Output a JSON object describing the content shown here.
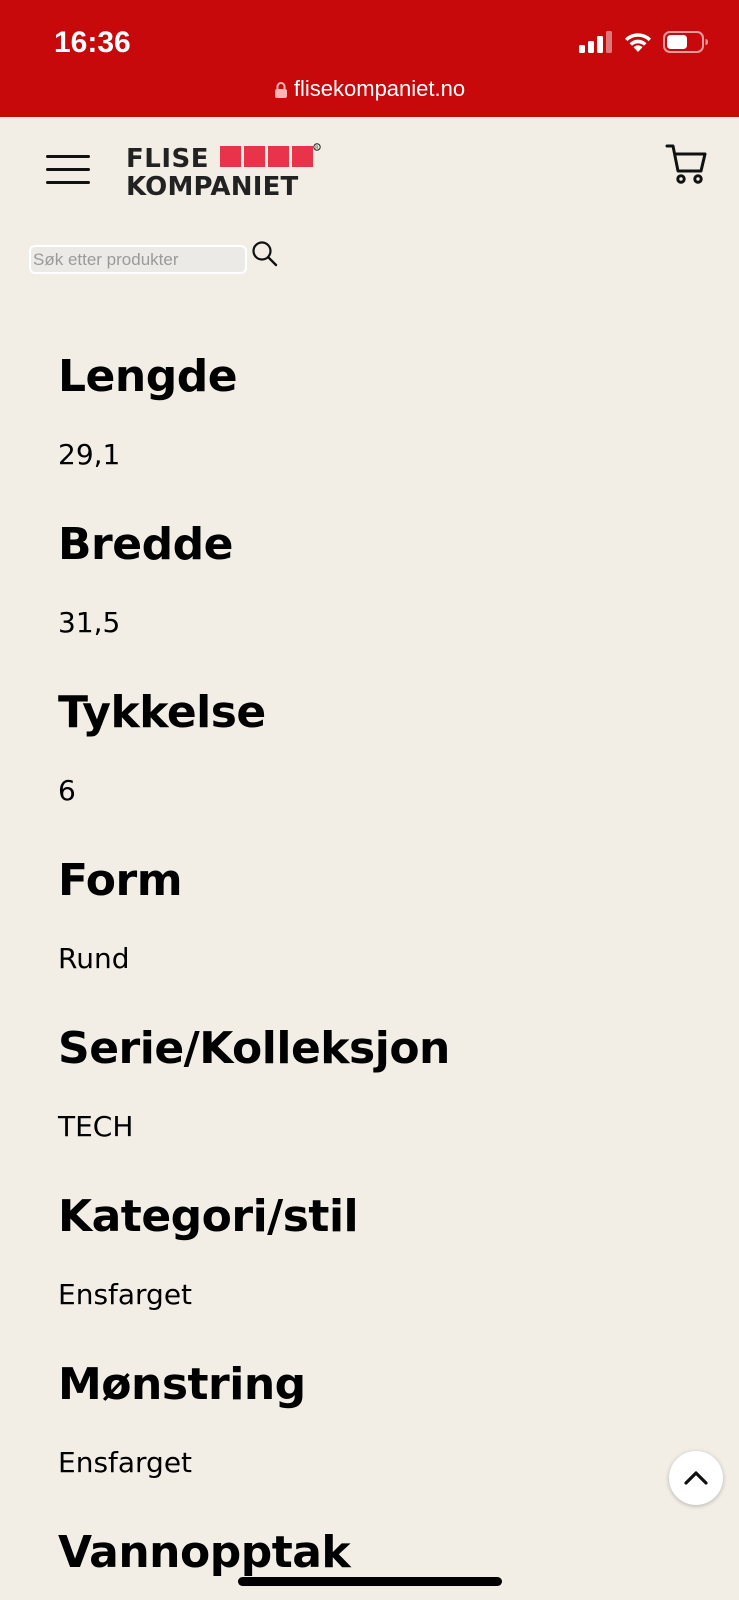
{
  "status_bar": {
    "time": "16:36",
    "icons": [
      "cellular-signal-icon",
      "wifi-icon",
      "battery-icon"
    ]
  },
  "browser": {
    "url": "flisekompaniet.no"
  },
  "header": {
    "logo_line1": "FLISE",
    "logo_line2": "KOMPANIET",
    "brand_color": "#e8334a"
  },
  "search": {
    "placeholder": "Søk etter produkter",
    "value": ""
  },
  "specs": [
    {
      "label": "Lengde",
      "value": "29,1"
    },
    {
      "label": "Bredde",
      "value": "31,5"
    },
    {
      "label": "Tykkelse",
      "value": "6"
    },
    {
      "label": "Form",
      "value": "Rund"
    },
    {
      "label": "Serie/Kolleksjon",
      "value": "TECH"
    },
    {
      "label": "Kategori/stil",
      "value": "Ensfarget"
    },
    {
      "label": "Mønstring",
      "value": "Ensfarget"
    },
    {
      "label": "Vannopptak",
      "value": ""
    }
  ],
  "colors": {
    "status_bar_bg": "#c8090b",
    "page_bg": "#f2eee6"
  }
}
